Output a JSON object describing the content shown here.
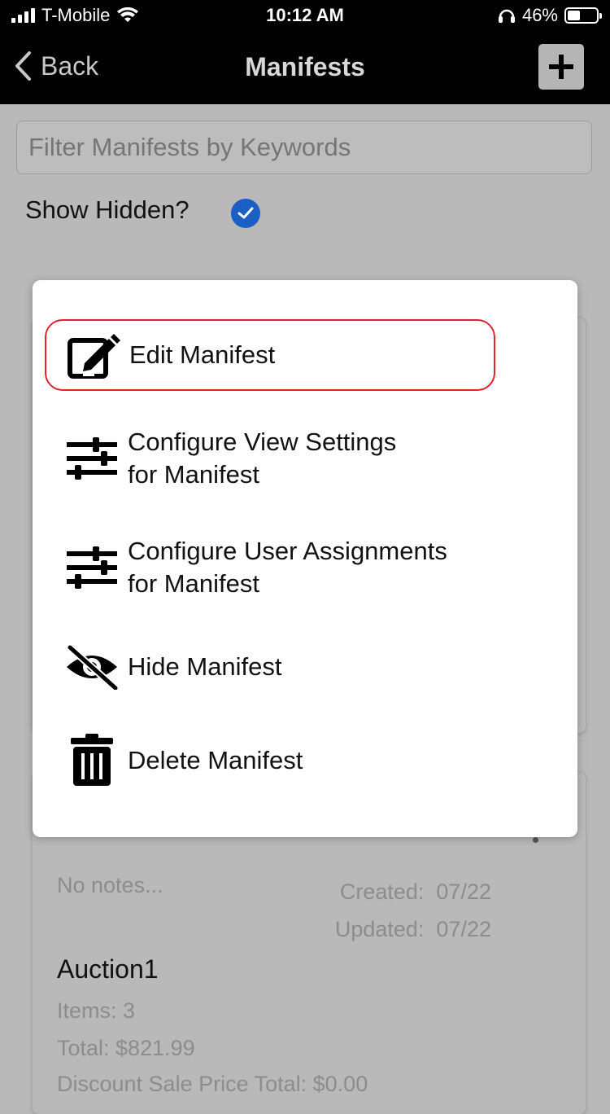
{
  "status_bar": {
    "carrier": "T-Mobile",
    "time": "10:12 AM",
    "battery": "46%"
  },
  "nav": {
    "back_label": "Back",
    "title": "Manifests",
    "add_icon": "plus-icon"
  },
  "filter": {
    "placeholder": "Filter Manifests by Keywords",
    "value": ""
  },
  "show_hidden": {
    "label": "Show Hidden?",
    "checked": true
  },
  "menu": {
    "items": [
      {
        "label": "Edit Manifest",
        "icon": "edit-icon"
      },
      {
        "label": "Configure View Settings\nfor Manifest",
        "icon": "sliders-icon"
      },
      {
        "label": "Configure User Assignments\nfor Manifest",
        "icon": "sliders-icon"
      },
      {
        "label": "Hide Manifest",
        "icon": "eye-slash-icon"
      },
      {
        "label": "Delete Manifest",
        "icon": "trash-icon"
      }
    ]
  },
  "background_card": {
    "notes": "No notes...",
    "created": "Created:  07/22",
    "updated": "Updated:  07/22",
    "name": "Auction1",
    "items": "Items: 3",
    "total": "Total: $821.99",
    "discount": "Discount Sale Price Total: $0.00"
  }
}
